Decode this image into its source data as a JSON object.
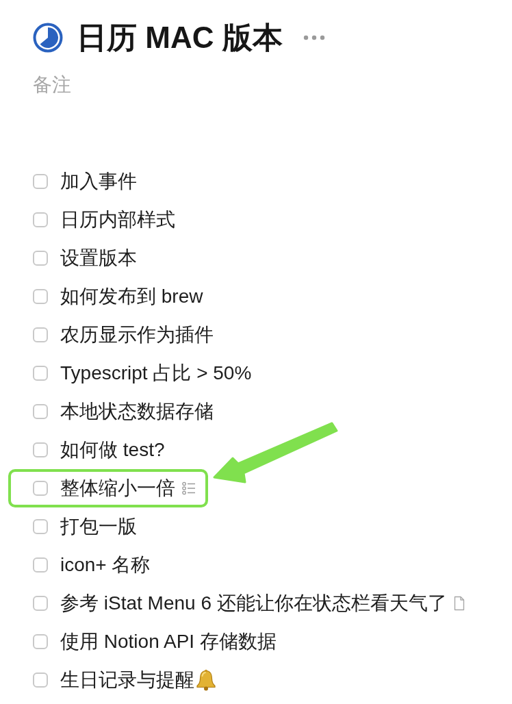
{
  "page": {
    "title": "日历 MAC 版本",
    "note": "备注"
  },
  "tasks": [
    {
      "text": "加入事件",
      "checked": false,
      "highlighted": false,
      "kind": "plain"
    },
    {
      "text": "日历内部样式",
      "checked": false,
      "highlighted": false,
      "kind": "plain"
    },
    {
      "text": "设置版本",
      "checked": false,
      "highlighted": false,
      "kind": "plain"
    },
    {
      "text": "如何发布到 brew",
      "checked": false,
      "highlighted": false,
      "kind": "plain"
    },
    {
      "text": "农历显示作为插件",
      "checked": false,
      "highlighted": false,
      "kind": "plain"
    },
    {
      "text": "Typescript 占比 > 50%",
      "checked": false,
      "highlighted": false,
      "kind": "plain"
    },
    {
      "text": "本地状态数据存储",
      "checked": false,
      "highlighted": false,
      "kind": "plain"
    },
    {
      "text": "如何做 test?",
      "checked": false,
      "highlighted": false,
      "kind": "plain"
    },
    {
      "text": "整体缩小一倍",
      "checked": false,
      "highlighted": true,
      "kind": "subtasks"
    },
    {
      "text": "打包一版",
      "checked": false,
      "highlighted": false,
      "kind": "plain"
    },
    {
      "text": "icon+ 名称",
      "checked": false,
      "highlighted": false,
      "kind": "plain"
    },
    {
      "text": "参考 iStat Menu 6 还能让你在状态栏看天气了",
      "checked": false,
      "highlighted": false,
      "kind": "note"
    },
    {
      "text": "使用 Notion API 存储数据",
      "checked": false,
      "highlighted": false,
      "kind": "plain"
    },
    {
      "text": "生日记录与提醒",
      "checked": false,
      "highlighted": false,
      "kind": "reminder"
    }
  ]
}
